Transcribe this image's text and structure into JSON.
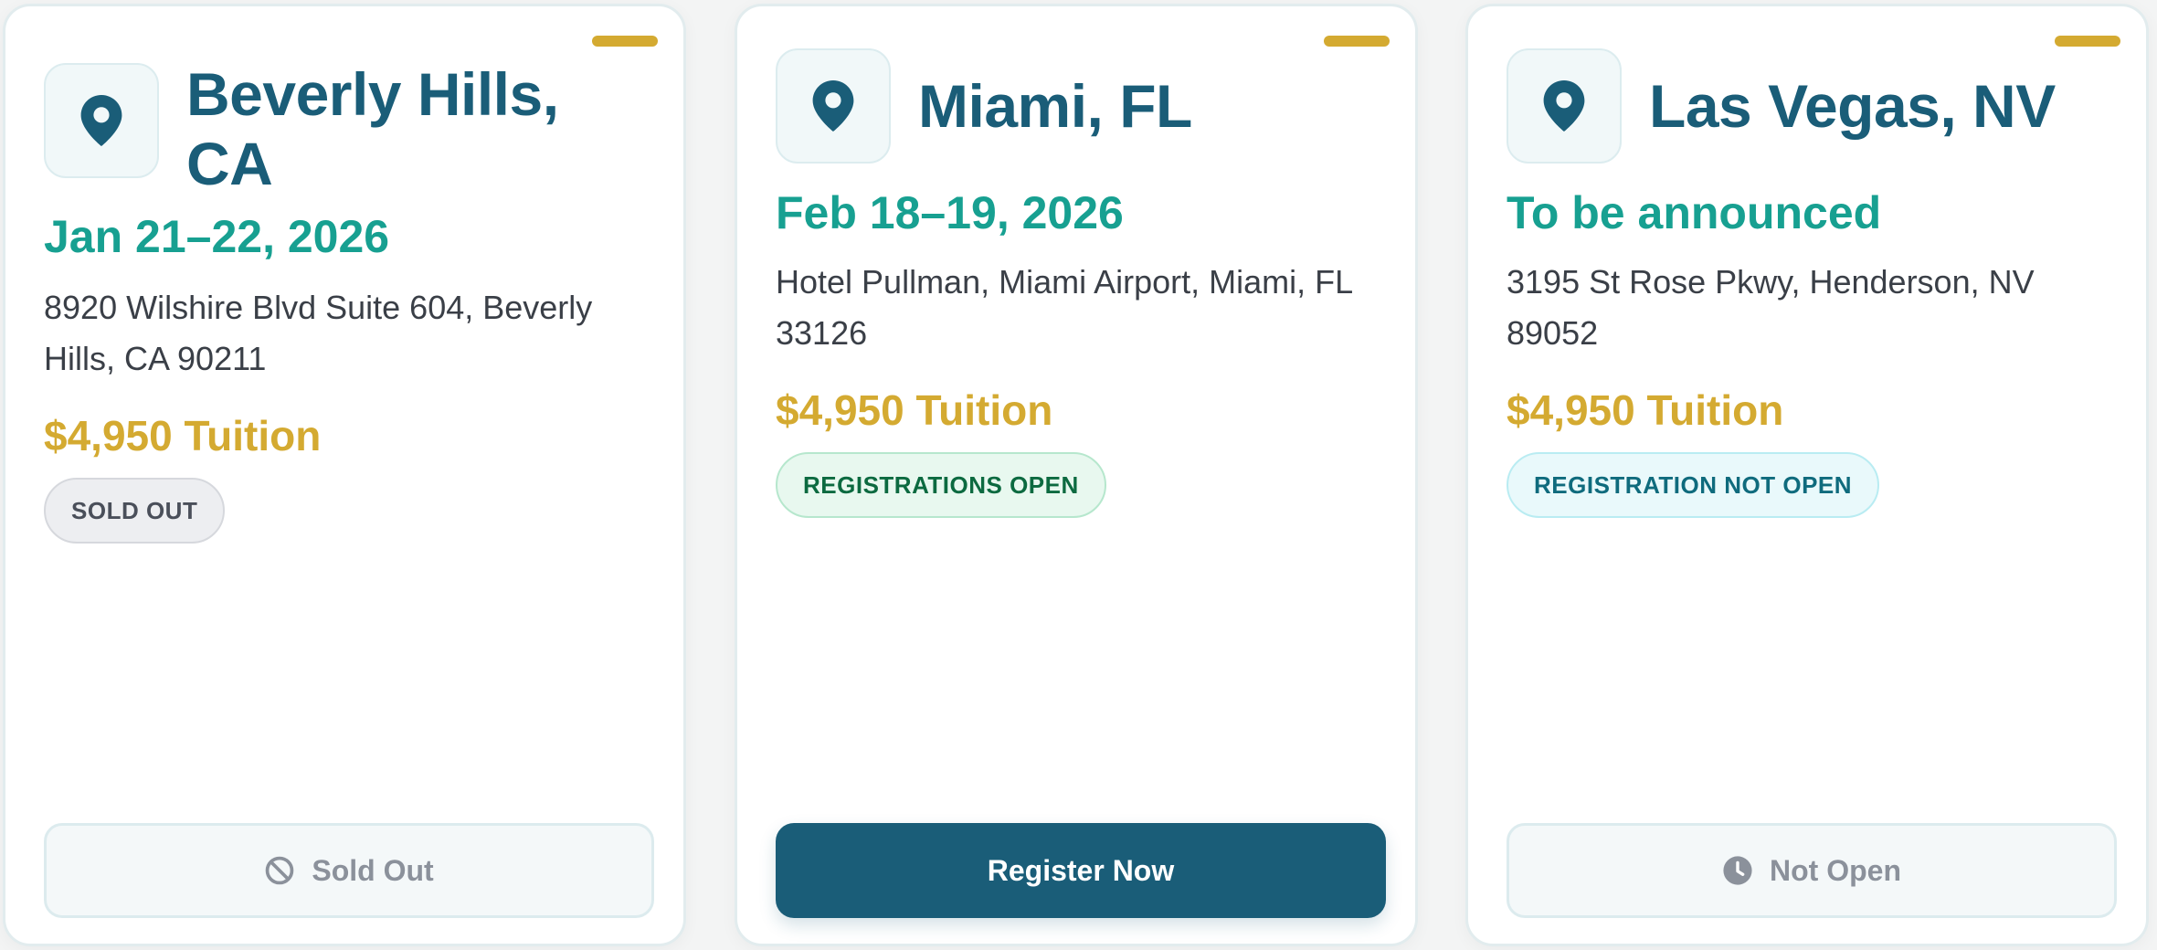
{
  "colors": {
    "primary": "#1a5d78",
    "teal": "#17a091",
    "gold": "#d4aa31"
  },
  "cards": [
    {
      "city": "Beverly Hills, CA",
      "date": "Jan 21–22, 2026",
      "address": "8920 Wilshire Blvd Suite 604, Beverly Hills, CA 90211",
      "price": "$4,950 Tuition",
      "badge": "SOLD OUT",
      "button_label": "Sold Out",
      "button_icon": "ban-icon"
    },
    {
      "city": "Miami, FL",
      "date": "Feb 18–19, 2026",
      "address": "Hotel Pullman, Miami Airport, Miami, FL 33126",
      "price": "$4,950 Tuition",
      "badge": "REGISTRATIONS OPEN",
      "button_label": "Register Now"
    },
    {
      "city": "Las Vegas, NV",
      "date": "To be announced",
      "address": "3195 St Rose Pkwy, Henderson, NV 89052",
      "price": "$4,950 Tuition",
      "badge": "REGISTRATION NOT OPEN",
      "button_label": "Not Open",
      "button_icon": "clock-icon"
    }
  ]
}
